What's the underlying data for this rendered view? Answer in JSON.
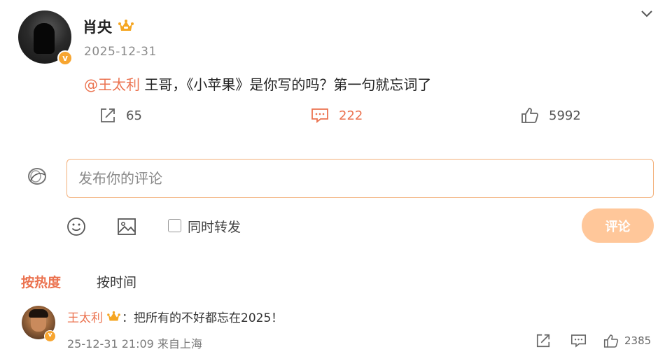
{
  "post": {
    "author": "肖央",
    "date": "2025-12-31",
    "mention": "@王太利",
    "text": " 王哥，《小苹果》是你写的吗？第一句就忘词了",
    "actions": {
      "reposts": "65",
      "comments": "222",
      "likes": "5992"
    }
  },
  "composer": {
    "placeholder": "发布你的评论",
    "sync_label": "同时转发",
    "submit_label": "评论"
  },
  "sort_tabs": {
    "hot": "按热度",
    "time": "按时间"
  },
  "comments": [
    {
      "author": "王太利",
      "text": "：把所有的不好都忘在2025！",
      "meta": "25-12-31 21:09 来自上海",
      "likes": "2385"
    }
  ],
  "colors": {
    "accent": "#eb7350",
    "submit_bg": "#ffc79a",
    "input_border": "#f3b07a",
    "badge": "#f7a530"
  },
  "icons": [
    "crown-icon",
    "chevron-down-icon",
    "repost-icon",
    "comment-icon",
    "like-icon",
    "emoji-icon",
    "image-icon",
    "checkbox"
  ]
}
